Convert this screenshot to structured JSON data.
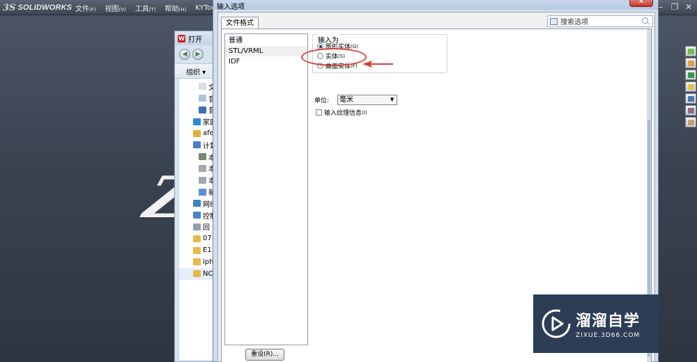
{
  "app": {
    "logo_mark": "3S",
    "logo_name": "SOLIDWORKS",
    "menus": [
      {
        "label": "文件",
        "key": "(F)"
      },
      {
        "label": "视图",
        "key": "(V)"
      },
      {
        "label": "工具",
        "key": "(T)"
      },
      {
        "label": "帮助",
        "key": "(H)"
      },
      {
        "label": "KYTool",
        "key": ""
      }
    ],
    "window_controls": [
      "–",
      "❐",
      "✕"
    ]
  },
  "open_window": {
    "title": "打开",
    "organize": "组织 ▾",
    "items": [
      {
        "label": "文",
        "color": "#d8dde4"
      },
      {
        "label": "音",
        "color": "#aac4e0"
      },
      {
        "label": "音",
        "color": "#3d70b0"
      },
      {
        "label": "家庭",
        "color": "#2b8ad8"
      },
      {
        "label": "afe",
        "color": "#e2b040"
      },
      {
        "label": "计算",
        "color": "#4a7fc4"
      },
      {
        "label": "本",
        "color": "#7a8a70"
      },
      {
        "label": "本",
        "color": "#a0a8b0"
      },
      {
        "label": "本",
        "color": "#a0a8b0"
      },
      {
        "label": "新",
        "color": "#5a8fd0"
      },
      {
        "label": "网络",
        "color": "#3a82c8"
      },
      {
        "label": "控制",
        "color": "#4a86c8"
      },
      {
        "label": "回",
        "color": "#90a0b0"
      },
      {
        "label": "07",
        "color": "#e6b94a"
      },
      {
        "label": "E1",
        "color": "#e6b94a"
      },
      {
        "label": "iph",
        "color": "#e6b94a"
      },
      {
        "label": "NC",
        "color": "#e6b94a"
      }
    ]
  },
  "dialog": {
    "title": "输入选项",
    "close": "✕",
    "tab": "文件格式",
    "search_placeholder": "搜索选项",
    "categories": [
      "普通",
      "STL/VRML",
      "IDF"
    ],
    "selected_category": "STL/VRML",
    "import_as": {
      "title": "输入为",
      "options": [
        {
          "label": "图形实体",
          "key": "(G)",
          "checked": true
        },
        {
          "label": "实体",
          "key": "(S)",
          "checked": false
        },
        {
          "label": "曲面实体",
          "key": "(F)",
          "checked": false
        }
      ]
    },
    "unit_label": "单位:",
    "unit_value": "毫米",
    "texture_label": "输入纹理信息",
    "texture_key": "(I)",
    "texture_checked": false,
    "reset_label": "重设(R)..."
  },
  "annotation": {
    "color": "#d6413a"
  },
  "watermark": {
    "big": "溜溜自学",
    "small": "ZIXUE.3D66.COM",
    "bg_color": "#2c3d55"
  },
  "background_glyph": "Z"
}
